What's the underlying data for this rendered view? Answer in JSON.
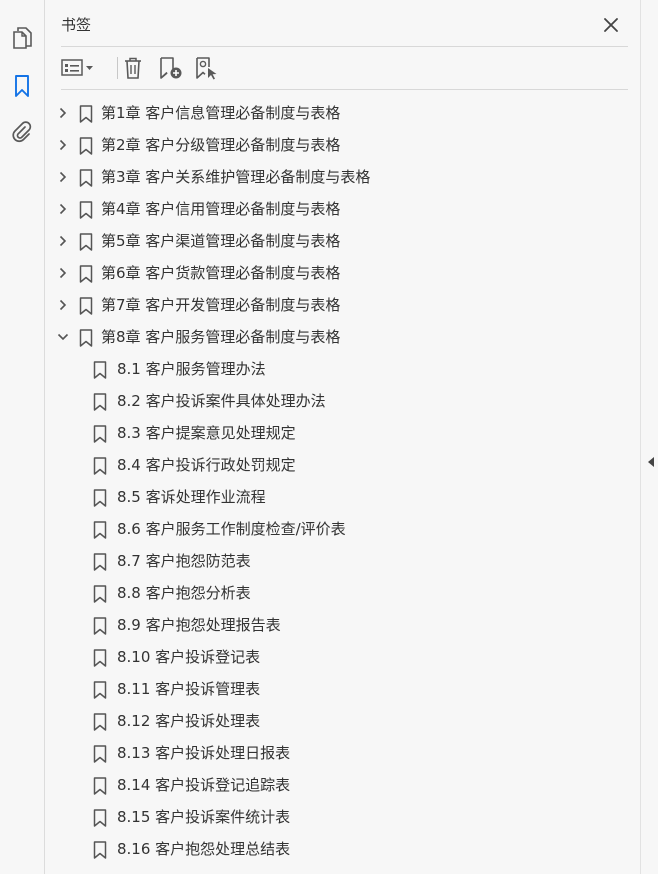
{
  "panel": {
    "title": "书签",
    "close_icon": "close-icon"
  },
  "rail": {
    "icons": [
      "pages-icon",
      "bookmark-icon",
      "attachment-icon"
    ],
    "active": "bookmark-icon"
  },
  "toolbar": {
    "icons": [
      "options-menu-icon",
      "delete-bookmark-icon",
      "new-bookmark-icon",
      "find-bookmark-icon"
    ]
  },
  "bookmarks": [
    {
      "label": "第1章 客户信息管理必备制度与表格",
      "expanded": false
    },
    {
      "label": "第2章 客户分级管理必备制度与表格",
      "expanded": false
    },
    {
      "label": "第3章 客户关系维护管理必备制度与表格",
      "expanded": false
    },
    {
      "label": "第4章 客户信用管理必备制度与表格",
      "expanded": false
    },
    {
      "label": "第5章 客户渠道管理必备制度与表格",
      "expanded": false
    },
    {
      "label": "第6章 客户货款管理必备制度与表格",
      "expanded": false
    },
    {
      "label": "第7章 客户开发管理必备制度与表格",
      "expanded": false
    },
    {
      "label": "第8章 客户服务管理必备制度与表格",
      "expanded": true
    },
    {
      "label": "8.1 客户服务管理办法",
      "child": true
    },
    {
      "label": "8.2 客户投诉案件具体处理办法",
      "child": true
    },
    {
      "label": "8.3 客户提案意见处理规定",
      "child": true
    },
    {
      "label": "8.4 客户投诉行政处罚规定",
      "child": true
    },
    {
      "label": "8.5 客诉处理作业流程",
      "child": true
    },
    {
      "label": "8.6 客户服务工作制度检查/评价表",
      "child": true
    },
    {
      "label": "8.7 客户抱怨防范表",
      "child": true
    },
    {
      "label": "8.8 客户抱怨分析表",
      "child": true
    },
    {
      "label": "8.9 客户抱怨处理报告表",
      "child": true
    },
    {
      "label": "8.10 客户投诉登记表",
      "child": true
    },
    {
      "label": "8.11 客户投诉管理表",
      "child": true
    },
    {
      "label": "8.12 客户投诉处理表",
      "child": true
    },
    {
      "label": "8.13 客户投诉处理日报表",
      "child": true
    },
    {
      "label": "8.14 客户投诉登记追踪表",
      "child": true
    },
    {
      "label": "8.15 客户投诉案件统计表",
      "child": true
    },
    {
      "label": "8.16 客户抱怨处理总结表",
      "child": true
    }
  ],
  "colors": {
    "accent": "#1473e6",
    "icon": "#5a5a5a",
    "background": "#f7f7f7"
  }
}
